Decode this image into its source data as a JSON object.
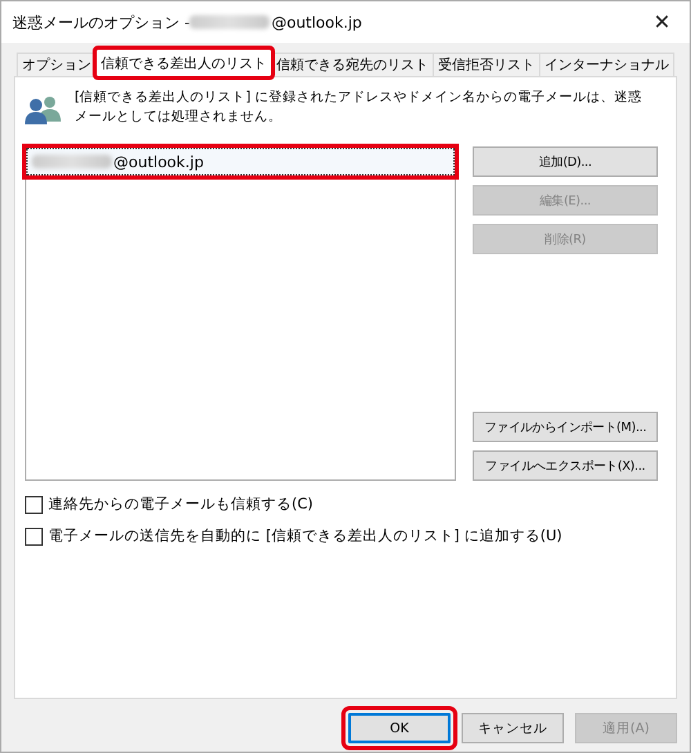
{
  "window": {
    "title_prefix": "迷惑メールのオプション - ",
    "title_suffix": "@outlook.jp",
    "close": "✕"
  },
  "tabs": [
    {
      "label": "オプション",
      "selected": false,
      "highlighted": false
    },
    {
      "label": "信頼できる差出人のリスト",
      "selected": true,
      "highlighted": true
    },
    {
      "label": "信頼できる宛先のリスト",
      "selected": false,
      "highlighted": false
    },
    {
      "label": "受信拒否リスト",
      "selected": false,
      "highlighted": false
    },
    {
      "label": "インターナショナル",
      "selected": false,
      "highlighted": false
    }
  ],
  "description": "[信頼できる差出人のリスト] に登録されたアドレスやドメイン名からの電子メールは、迷惑メールとしては処理されません。",
  "list": [
    {
      "suffix": "@outlook.jp",
      "selected": true,
      "highlighted": true
    }
  ],
  "side_buttons": [
    {
      "label": "追加(D)...",
      "disabled": false
    },
    {
      "label": "編集(E)...",
      "disabled": true
    },
    {
      "label": "削除(R)",
      "disabled": true
    }
  ],
  "file_buttons": [
    {
      "label": "ファイルからインポート(M)...",
      "disabled": false
    },
    {
      "label": "ファイルへエクスポート(X)...",
      "disabled": false
    }
  ],
  "checkboxes": [
    {
      "label": "連絡先からの電子メールも信頼する(C)",
      "checked": false
    },
    {
      "label": "電子メールの送信先を自動的に [信頼できる差出人のリスト] に追加する(U)",
      "checked": false
    }
  ],
  "footer_buttons": [
    {
      "label": "OK",
      "disabled": false,
      "default": true,
      "highlighted": true
    },
    {
      "label": "キャンセル",
      "disabled": false,
      "default": false,
      "highlighted": false
    },
    {
      "label": "適用(A)",
      "disabled": true,
      "default": false,
      "highlighted": false
    }
  ]
}
